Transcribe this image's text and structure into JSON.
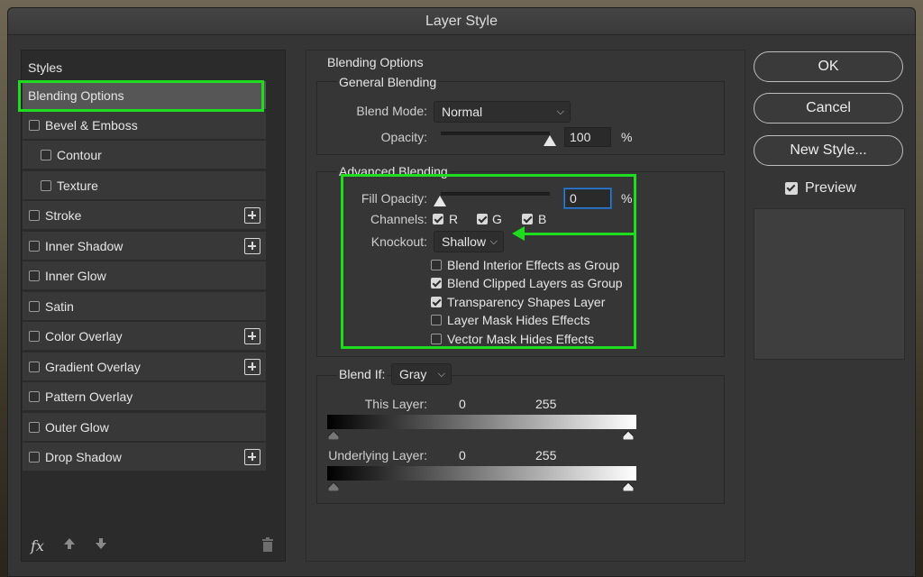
{
  "window": {
    "title": "Layer Style"
  },
  "styles": {
    "header": "Styles",
    "items": [
      {
        "label": "Blending Options",
        "checkbox": false,
        "plus": false,
        "selected": true,
        "indent": 0
      },
      {
        "label": "Bevel & Emboss",
        "checkbox": true,
        "plus": false,
        "indent": 0
      },
      {
        "label": "Contour",
        "checkbox": true,
        "plus": false,
        "indent": 1
      },
      {
        "label": "Texture",
        "checkbox": true,
        "plus": false,
        "indent": 1
      },
      {
        "label": "Stroke",
        "checkbox": true,
        "plus": true,
        "indent": 0
      },
      {
        "label": "Inner Shadow",
        "checkbox": true,
        "plus": true,
        "indent": 0
      },
      {
        "label": "Inner Glow",
        "checkbox": true,
        "plus": false,
        "indent": 0
      },
      {
        "label": "Satin",
        "checkbox": true,
        "plus": false,
        "indent": 0
      },
      {
        "label": "Color Overlay",
        "checkbox": true,
        "plus": true,
        "indent": 0
      },
      {
        "label": "Gradient Overlay",
        "checkbox": true,
        "plus": true,
        "indent": 0
      },
      {
        "label": "Pattern Overlay",
        "checkbox": true,
        "plus": false,
        "indent": 0
      },
      {
        "label": "Outer Glow",
        "checkbox": true,
        "plus": false,
        "indent": 0
      },
      {
        "label": "Drop Shadow",
        "checkbox": true,
        "plus": true,
        "indent": 0
      }
    ],
    "footer": {
      "fx_label": "fx"
    }
  },
  "blending": {
    "section_title": "Blending Options",
    "general": {
      "title": "General Blending",
      "blend_mode_label": "Blend Mode:",
      "blend_mode_value": "Normal",
      "opacity_label": "Opacity:",
      "opacity_value": "100",
      "opacity_unit": "%",
      "opacity_level": 1.0
    },
    "advanced": {
      "title": "Advanced Blending",
      "fill_opacity_label": "Fill Opacity:",
      "fill_opacity_value": "0",
      "fill_opacity_unit": "%",
      "fill_opacity_level": 0.0,
      "channels_label": "Channels:",
      "channels": [
        {
          "label": "R",
          "checked": true
        },
        {
          "label": "G",
          "checked": true
        },
        {
          "label": "B",
          "checked": true
        }
      ],
      "knockout_label": "Knockout:",
      "knockout_value": "Shallow",
      "options": [
        {
          "label": "Blend Interior Effects as Group",
          "checked": false
        },
        {
          "label": "Blend Clipped Layers as Group",
          "checked": true
        },
        {
          "label": "Transparency Shapes Layer",
          "checked": true
        },
        {
          "label": "Layer Mask Hides Effects",
          "checked": false
        },
        {
          "label": "Vector Mask Hides Effects",
          "checked": false
        }
      ]
    },
    "blend_if": {
      "label": "Blend If:",
      "value": "Gray",
      "this_layer_label": "This Layer:",
      "this_layer_min": "0",
      "this_layer_max": "255",
      "underlying_label": "Underlying Layer:",
      "underlying_min": "0",
      "underlying_max": "255"
    }
  },
  "buttons": {
    "ok": "OK",
    "cancel": "Cancel",
    "new_style": "New Style...",
    "preview_label": "Preview",
    "preview_checked": true
  },
  "colors": {
    "annotation": "#1edc1e",
    "dialog_bg": "#353535",
    "focus_blue": "#2f7ed8"
  }
}
